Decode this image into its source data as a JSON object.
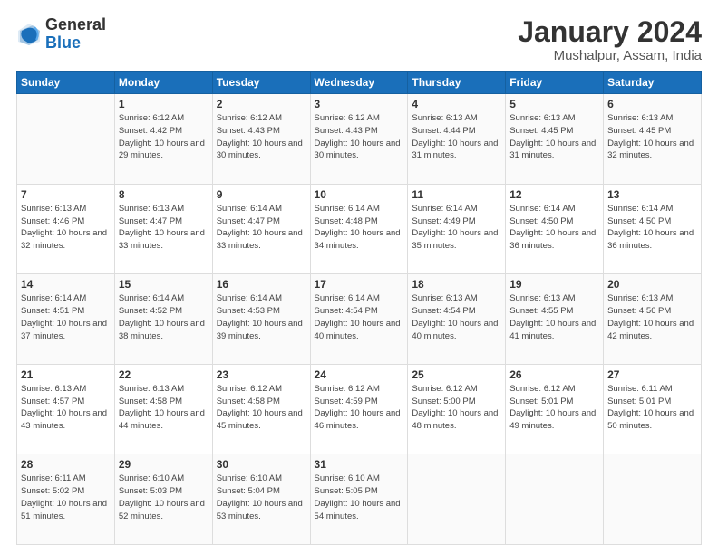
{
  "header": {
    "logo_general": "General",
    "logo_blue": "Blue",
    "title": "January 2024",
    "subtitle": "Mushalpur, Assam, India"
  },
  "calendar": {
    "days_of_week": [
      "Sunday",
      "Monday",
      "Tuesday",
      "Wednesday",
      "Thursday",
      "Friday",
      "Saturday"
    ],
    "weeks": [
      [
        {
          "num": "",
          "sunrise": "",
          "sunset": "",
          "daylight": ""
        },
        {
          "num": "1",
          "sunrise": "Sunrise: 6:12 AM",
          "sunset": "Sunset: 4:42 PM",
          "daylight": "Daylight: 10 hours and 29 minutes."
        },
        {
          "num": "2",
          "sunrise": "Sunrise: 6:12 AM",
          "sunset": "Sunset: 4:43 PM",
          "daylight": "Daylight: 10 hours and 30 minutes."
        },
        {
          "num": "3",
          "sunrise": "Sunrise: 6:12 AM",
          "sunset": "Sunset: 4:43 PM",
          "daylight": "Daylight: 10 hours and 30 minutes."
        },
        {
          "num": "4",
          "sunrise": "Sunrise: 6:13 AM",
          "sunset": "Sunset: 4:44 PM",
          "daylight": "Daylight: 10 hours and 31 minutes."
        },
        {
          "num": "5",
          "sunrise": "Sunrise: 6:13 AM",
          "sunset": "Sunset: 4:45 PM",
          "daylight": "Daylight: 10 hours and 31 minutes."
        },
        {
          "num": "6",
          "sunrise": "Sunrise: 6:13 AM",
          "sunset": "Sunset: 4:45 PM",
          "daylight": "Daylight: 10 hours and 32 minutes."
        }
      ],
      [
        {
          "num": "7",
          "sunrise": "Sunrise: 6:13 AM",
          "sunset": "Sunset: 4:46 PM",
          "daylight": "Daylight: 10 hours and 32 minutes."
        },
        {
          "num": "8",
          "sunrise": "Sunrise: 6:13 AM",
          "sunset": "Sunset: 4:47 PM",
          "daylight": "Daylight: 10 hours and 33 minutes."
        },
        {
          "num": "9",
          "sunrise": "Sunrise: 6:14 AM",
          "sunset": "Sunset: 4:47 PM",
          "daylight": "Daylight: 10 hours and 33 minutes."
        },
        {
          "num": "10",
          "sunrise": "Sunrise: 6:14 AM",
          "sunset": "Sunset: 4:48 PM",
          "daylight": "Daylight: 10 hours and 34 minutes."
        },
        {
          "num": "11",
          "sunrise": "Sunrise: 6:14 AM",
          "sunset": "Sunset: 4:49 PM",
          "daylight": "Daylight: 10 hours and 35 minutes."
        },
        {
          "num": "12",
          "sunrise": "Sunrise: 6:14 AM",
          "sunset": "Sunset: 4:50 PM",
          "daylight": "Daylight: 10 hours and 36 minutes."
        },
        {
          "num": "13",
          "sunrise": "Sunrise: 6:14 AM",
          "sunset": "Sunset: 4:50 PM",
          "daylight": "Daylight: 10 hours and 36 minutes."
        }
      ],
      [
        {
          "num": "14",
          "sunrise": "Sunrise: 6:14 AM",
          "sunset": "Sunset: 4:51 PM",
          "daylight": "Daylight: 10 hours and 37 minutes."
        },
        {
          "num": "15",
          "sunrise": "Sunrise: 6:14 AM",
          "sunset": "Sunset: 4:52 PM",
          "daylight": "Daylight: 10 hours and 38 minutes."
        },
        {
          "num": "16",
          "sunrise": "Sunrise: 6:14 AM",
          "sunset": "Sunset: 4:53 PM",
          "daylight": "Daylight: 10 hours and 39 minutes."
        },
        {
          "num": "17",
          "sunrise": "Sunrise: 6:14 AM",
          "sunset": "Sunset: 4:54 PM",
          "daylight": "Daylight: 10 hours and 40 minutes."
        },
        {
          "num": "18",
          "sunrise": "Sunrise: 6:13 AM",
          "sunset": "Sunset: 4:54 PM",
          "daylight": "Daylight: 10 hours and 40 minutes."
        },
        {
          "num": "19",
          "sunrise": "Sunrise: 6:13 AM",
          "sunset": "Sunset: 4:55 PM",
          "daylight": "Daylight: 10 hours and 41 minutes."
        },
        {
          "num": "20",
          "sunrise": "Sunrise: 6:13 AM",
          "sunset": "Sunset: 4:56 PM",
          "daylight": "Daylight: 10 hours and 42 minutes."
        }
      ],
      [
        {
          "num": "21",
          "sunrise": "Sunrise: 6:13 AM",
          "sunset": "Sunset: 4:57 PM",
          "daylight": "Daylight: 10 hours and 43 minutes."
        },
        {
          "num": "22",
          "sunrise": "Sunrise: 6:13 AM",
          "sunset": "Sunset: 4:58 PM",
          "daylight": "Daylight: 10 hours and 44 minutes."
        },
        {
          "num": "23",
          "sunrise": "Sunrise: 6:12 AM",
          "sunset": "Sunset: 4:58 PM",
          "daylight": "Daylight: 10 hours and 45 minutes."
        },
        {
          "num": "24",
          "sunrise": "Sunrise: 6:12 AM",
          "sunset": "Sunset: 4:59 PM",
          "daylight": "Daylight: 10 hours and 46 minutes."
        },
        {
          "num": "25",
          "sunrise": "Sunrise: 6:12 AM",
          "sunset": "Sunset: 5:00 PM",
          "daylight": "Daylight: 10 hours and 48 minutes."
        },
        {
          "num": "26",
          "sunrise": "Sunrise: 6:12 AM",
          "sunset": "Sunset: 5:01 PM",
          "daylight": "Daylight: 10 hours and 49 minutes."
        },
        {
          "num": "27",
          "sunrise": "Sunrise: 6:11 AM",
          "sunset": "Sunset: 5:01 PM",
          "daylight": "Daylight: 10 hours and 50 minutes."
        }
      ],
      [
        {
          "num": "28",
          "sunrise": "Sunrise: 6:11 AM",
          "sunset": "Sunset: 5:02 PM",
          "daylight": "Daylight: 10 hours and 51 minutes."
        },
        {
          "num": "29",
          "sunrise": "Sunrise: 6:10 AM",
          "sunset": "Sunset: 5:03 PM",
          "daylight": "Daylight: 10 hours and 52 minutes."
        },
        {
          "num": "30",
          "sunrise": "Sunrise: 6:10 AM",
          "sunset": "Sunset: 5:04 PM",
          "daylight": "Daylight: 10 hours and 53 minutes."
        },
        {
          "num": "31",
          "sunrise": "Sunrise: 6:10 AM",
          "sunset": "Sunset: 5:05 PM",
          "daylight": "Daylight: 10 hours and 54 minutes."
        },
        {
          "num": "",
          "sunrise": "",
          "sunset": "",
          "daylight": ""
        },
        {
          "num": "",
          "sunrise": "",
          "sunset": "",
          "daylight": ""
        },
        {
          "num": "",
          "sunrise": "",
          "sunset": "",
          "daylight": ""
        }
      ]
    ]
  }
}
